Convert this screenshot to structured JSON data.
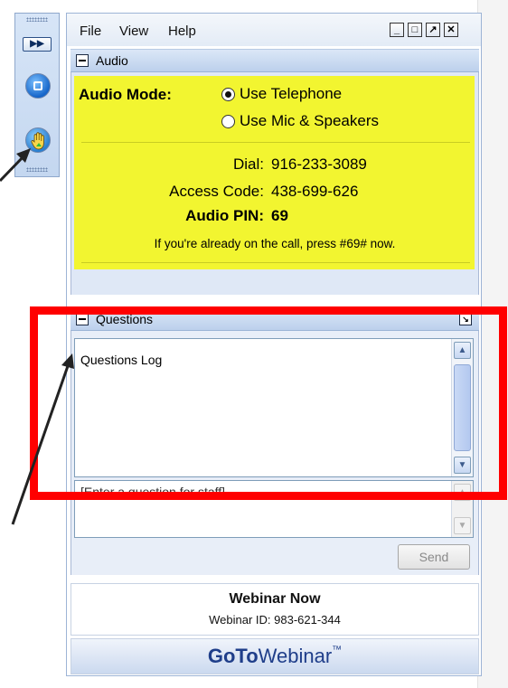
{
  "colors": {
    "highlight": "#ff0000",
    "audio_background": "#f2f530",
    "brand_blue": "#1f3e8a"
  },
  "menu": {
    "file": "File",
    "view": "View",
    "help": "Help"
  },
  "window_controls": {
    "minimize_icon": "minimize-icon",
    "restore_icon": "restore-icon",
    "popout_icon": "popout-icon",
    "close_icon": "close-icon"
  },
  "mini_toolbar": {
    "fast_forward_icon": "fast-forward-icon",
    "panel_icon": "panel-toggle-icon",
    "hand_icon": "raise-hand-icon"
  },
  "audio": {
    "title": "Audio",
    "mode_label": "Audio Mode:",
    "options": [
      "Use Telephone",
      "Use Mic & Speakers"
    ],
    "selected": "Use Telephone",
    "dial_label": "Dial:",
    "dial_value": "916-233-3089",
    "access_label": "Access Code:",
    "access_value": "438-699-626",
    "pin_label": "Audio PIN:",
    "pin_value": "69",
    "note": "If you're already on the call, press #69# now."
  },
  "questions": {
    "title": "Questions",
    "log_text": "Questions Log",
    "input_placeholder": "[Enter a question for staff]",
    "send_label": "Send"
  },
  "footer": {
    "webinar_title": "Webinar Now",
    "webinar_id": "Webinar ID: 983-621-344"
  },
  "brand": {
    "part1": "Go",
    "part2": "To",
    "part3": "Webinar",
    "tm": "™"
  }
}
